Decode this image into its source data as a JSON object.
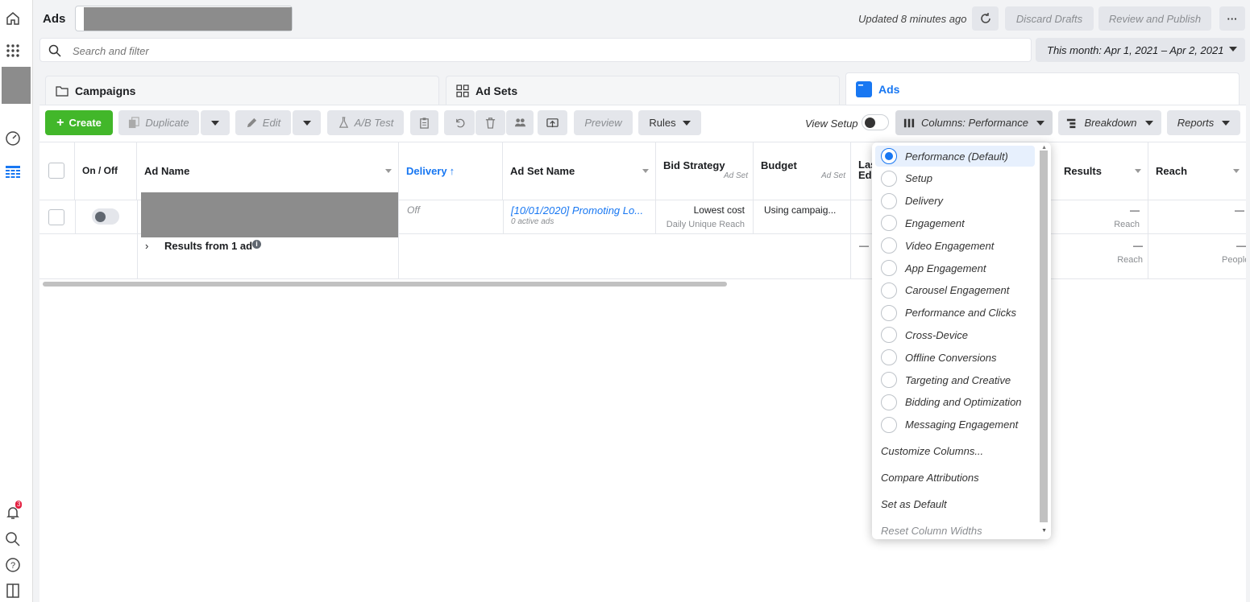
{
  "app": {
    "title": "Ads"
  },
  "header": {
    "updated": "Updated 8 minutes ago",
    "discard": "Discard Drafts",
    "review": "Review and Publish",
    "more": "···"
  },
  "search": {
    "placeholder": "Search and filter"
  },
  "daterange": {
    "label": "This month: Apr 1, 2021 – Apr 2, 2021"
  },
  "tabs": [
    {
      "label": "Campaigns"
    },
    {
      "label": "Ad Sets"
    },
    {
      "label": "Ads"
    }
  ],
  "toolbar": {
    "create": "Create",
    "duplicate": "Duplicate",
    "edit": "Edit",
    "abtest": "A/B Test",
    "preview": "Preview",
    "rules": "Rules",
    "view_setup": "View Setup",
    "columns": "Columns: Performance",
    "breakdown": "Breakdown",
    "reports": "Reports"
  },
  "table": {
    "headers": {
      "onoff": "On / Off",
      "adname": "Ad Name",
      "delivery": "Delivery",
      "adsetname": "Ad Set Name",
      "bid": "Bid Strategy",
      "bid_sub": "Ad Set",
      "budget": "Budget",
      "budget_sub": "Ad Set",
      "last": "Las",
      "last2": "Ed",
      "results": "Results",
      "reach": "Reach"
    },
    "row": {
      "delivery": "Off",
      "adset": "[10/01/2020] Promoting Lo...",
      "adset_sub": "0 active ads",
      "bid": "Lowest cost",
      "bid_sub": "Daily Unique Reach",
      "budget": "Using campaig...",
      "results": "—",
      "results_sub": "Reach",
      "reach": "—"
    },
    "summary": {
      "label": "Results from 1 ad",
      "last": "—",
      "results": "—",
      "results_sub": "Reach",
      "reach": "—",
      "reach_sub": "People"
    }
  },
  "columns_menu": {
    "presets": [
      "Performance (Default)",
      "Setup",
      "Delivery",
      "Engagement",
      "Video Engagement",
      "App Engagement",
      "Carousel Engagement",
      "Performance and Clicks",
      "Cross-Device",
      "Offline Conversions",
      "Targeting and Creative",
      "Bidding and Optimization",
      "Messaging Engagement"
    ],
    "selected_index": 0,
    "actions": [
      "Customize Columns...",
      "Compare Attributions",
      "Set as Default",
      "Reset Column Widths"
    ]
  },
  "notifications": {
    "count": "3"
  },
  "colors": {
    "accent": "#1877f2",
    "create": "#42b72a"
  }
}
